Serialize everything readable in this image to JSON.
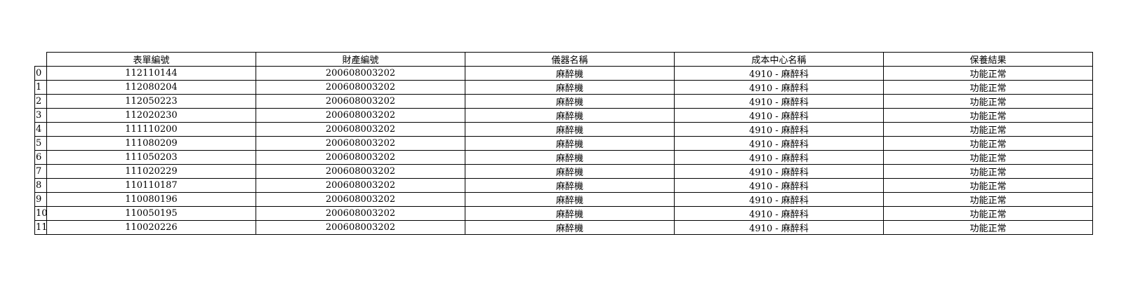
{
  "columns": [
    "表單編號",
    "財產編號",
    "儀器名稱",
    "成本中心名稱",
    "保養結果"
  ],
  "rows": [
    {
      "index": "0",
      "form_no": "112110144",
      "asset_no": "200608003202",
      "instrument": "麻醉機",
      "cost_center": "4910 - 麻醉科",
      "result": "功能正常"
    },
    {
      "index": "1",
      "form_no": "112080204",
      "asset_no": "200608003202",
      "instrument": "麻醉機",
      "cost_center": "4910 - 麻醉科",
      "result": "功能正常"
    },
    {
      "index": "2",
      "form_no": "112050223",
      "asset_no": "200608003202",
      "instrument": "麻醉機",
      "cost_center": "4910 - 麻醉科",
      "result": "功能正常"
    },
    {
      "index": "3",
      "form_no": "112020230",
      "asset_no": "200608003202",
      "instrument": "麻醉機",
      "cost_center": "4910 - 麻醉科",
      "result": "功能正常"
    },
    {
      "index": "4",
      "form_no": "111110200",
      "asset_no": "200608003202",
      "instrument": "麻醉機",
      "cost_center": "4910 - 麻醉科",
      "result": "功能正常"
    },
    {
      "index": "5",
      "form_no": "111080209",
      "asset_no": "200608003202",
      "instrument": "麻醉機",
      "cost_center": "4910 - 麻醉科",
      "result": "功能正常"
    },
    {
      "index": "6",
      "form_no": "111050203",
      "asset_no": "200608003202",
      "instrument": "麻醉機",
      "cost_center": "4910 - 麻醉科",
      "result": "功能正常"
    },
    {
      "index": "7",
      "form_no": "111020229",
      "asset_no": "200608003202",
      "instrument": "麻醉機",
      "cost_center": "4910 - 麻醉科",
      "result": "功能正常"
    },
    {
      "index": "8",
      "form_no": "110110187",
      "asset_no": "200608003202",
      "instrument": "麻醉機",
      "cost_center": "4910 - 麻醉科",
      "result": "功能正常"
    },
    {
      "index": "9",
      "form_no": "110080196",
      "asset_no": "200608003202",
      "instrument": "麻醉機",
      "cost_center": "4910 - 麻醉科",
      "result": "功能正常"
    },
    {
      "index": "10",
      "form_no": "110050195",
      "asset_no": "200608003202",
      "instrument": "麻醉機",
      "cost_center": "4910 - 麻醉科",
      "result": "功能正常"
    },
    {
      "index": "11",
      "form_no": "110020226",
      "asset_no": "200608003202",
      "instrument": "麻醉機",
      "cost_center": "4910 - 麻醉科",
      "result": "功能正常"
    }
  ]
}
